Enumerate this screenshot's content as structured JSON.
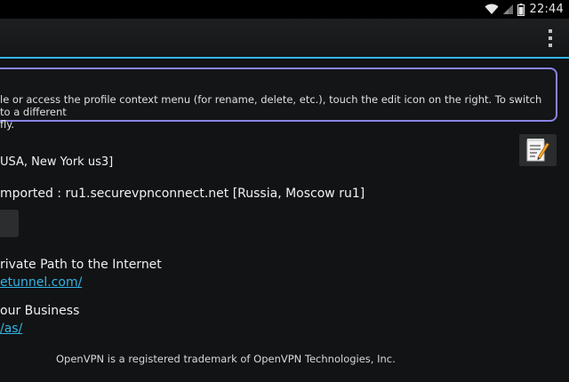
{
  "status_bar": {
    "time": "22:44"
  },
  "banner": {
    "line1": "le or access the profile context menu (for rename, delete, etc.), touch the edit icon on the right. To switch to a different",
    "line2": "fly."
  },
  "profiles": {
    "item1": "USA, New York us3]",
    "item2": "mported : ru1.securevpnconnect.net [Russia, Moscow ru1]"
  },
  "promo": [
    {
      "title": "rivate Path to the Internet",
      "link": "etunnel.com/"
    },
    {
      "title": "our Business",
      "link": "/as/"
    }
  ],
  "footer": "OpenVPN is a registered trademark of OpenVPN Technologies, Inc.",
  "icons": {
    "wifi": "wifi-icon",
    "signal": "signal-icon",
    "battery": "battery-icon",
    "overflow": "overflow-menu-icon",
    "edit": "edit-note-icon"
  },
  "colors": {
    "accent": "#33b5e5",
    "banner_border": "#8a84e8"
  }
}
